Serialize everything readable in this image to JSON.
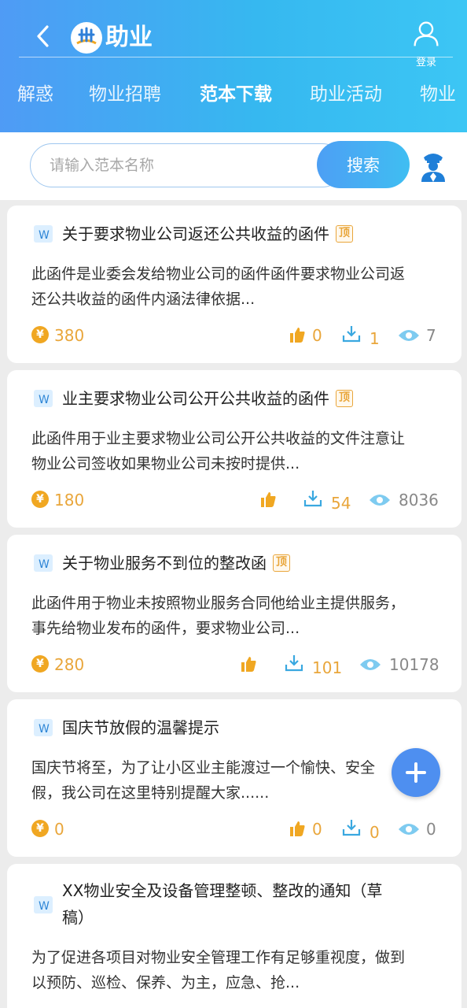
{
  "header": {
    "logo_text": "助业",
    "login_label": "登录"
  },
  "tabs": [
    "解惑",
    "物业招聘",
    "范本下载",
    "助业活动",
    "物业"
  ],
  "active_tab": "范本下载",
  "search": {
    "placeholder": "请输入范本名称",
    "button_label": "搜索"
  },
  "cards": [
    {
      "title": "关于要求物业公司返还公共收益的函件",
      "badge": "顶",
      "desc_line1": "此函件是业委会发给物业公司的函件函件要求物业公司返",
      "desc_line2": "还公共收益的函件内涵法律依据...",
      "price": "380",
      "likes": "0",
      "downloads": "1",
      "views": "7"
    },
    {
      "title": "业主要求物业公司公开公共收益的函件",
      "badge": "顶",
      "desc_line1": "此函件用于业主要求物业公司公开公共收益的文件注意让",
      "desc_line2": "物业公司签收如果物业公司未按时提供...",
      "price": "180",
      "likes": "",
      "downloads": "54",
      "views": "8036"
    },
    {
      "title": "关于物业服务不到位的整改函",
      "badge": "顶",
      "desc_line1": "此函件用于物业未按照物业服务合同他给业主提供服务，",
      "desc_line2": "事先给物业发布的函件，要求物业公司...",
      "price": "280",
      "likes": "",
      "downloads": "101",
      "views": "10178"
    },
    {
      "title": "国庆节放假的温馨提示",
      "badge": "",
      "desc_line1": "国庆节将至，为了让小区业主能渡过一个愉快、安全",
      "desc_line2": "假，我公司在这里特别提醒大家......",
      "price": "0",
      "likes": "0",
      "downloads": "0",
      "views": "0"
    },
    {
      "title_line1": "XX物业安全及设备管理整顿、整改的通知（草",
      "title_line2": "稿）",
      "desc_line1": "为了促进各项目对物业安全管理工作有足够重视度，做到",
      "desc_line2": "以预防、巡检、保养、为主，应急、抢..."
    }
  ],
  "coin_symbol": "¥",
  "colors": {
    "header_gradient_start": "#4f9bf5",
    "header_gradient_end": "#3cc6f4",
    "accent_orange": "#e9a63b",
    "icon_blue": "#3aa8e0",
    "fab_blue": "#4e8ff0"
  }
}
